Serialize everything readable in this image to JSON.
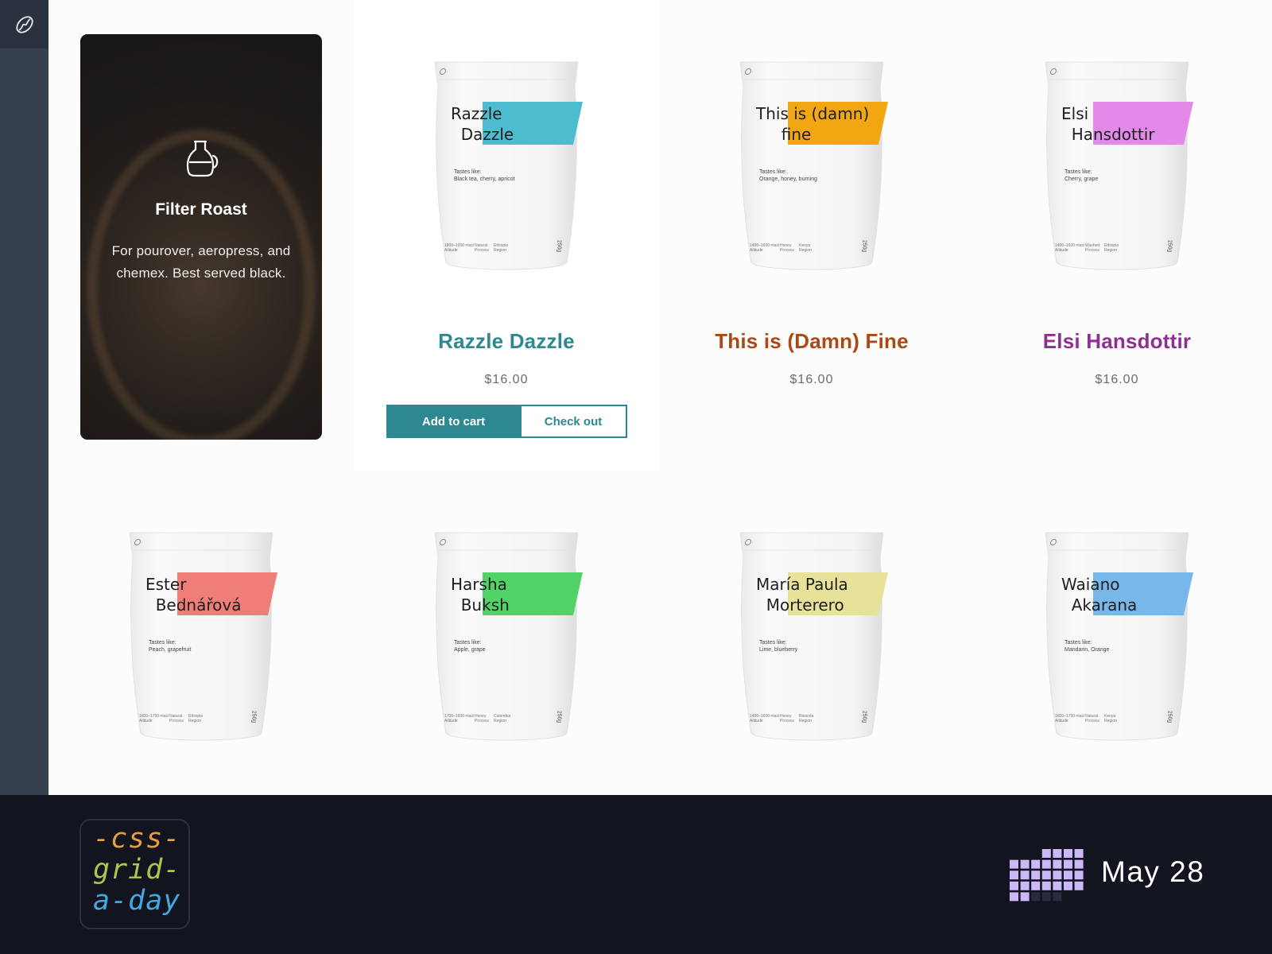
{
  "sidebar": {
    "logo_icon": "coffee-bean-icon"
  },
  "feature": {
    "icon": "coffee-pot-icon",
    "title": "Filter Roast",
    "description": "For pourover, aeropress, and chemex. Best served black."
  },
  "bag_common": {
    "tastes_label": "Tastes like:",
    "weight": "250g",
    "process_label": "Process",
    "region_label": "Region",
    "altitude_label": "Altitude"
  },
  "products": [
    {
      "name": "Razzle Dazzle",
      "bag_name": "Razzle\n  Dazzle",
      "tastes": "Black tea, cherry, apricot",
      "price": "$16.00",
      "color": "#2e8891",
      "bag_color": "#4bbdcf",
      "altitude": "1800–1950 masl",
      "process": "Natural",
      "region": "Ethiopia"
    },
    {
      "name": "This is (Damn) Fine",
      "bag_name": "This is (damn)\n     fine",
      "tastes": "Orange, honey, burning",
      "price": "$16.00",
      "color": "#a84a14",
      "bag_color": "#f2a611",
      "altitude": "1400–1600 masl",
      "process": "Honey",
      "region": "Kenya"
    },
    {
      "name": "Elsi Hansdottir",
      "bag_name": "Elsi\n  Hansdottir",
      "tastes": "Cherry, grape",
      "price": "$16.00",
      "color": "#8e2f92",
      "bag_color": "#e389e8",
      "altitude": "1400–1500 masl",
      "process": "Washed",
      "region": "Ethiopia"
    },
    {
      "name": "",
      "bag_name": "Ester\n  Bednářová",
      "tastes": "Peach, grapefruit",
      "price": "",
      "color": "#cc4c4c",
      "bag_color": "#ef7d78",
      "altitude": "1600–1750 masl",
      "process": "Natural",
      "region": "Ethiopia"
    },
    {
      "name": "",
      "bag_name": "Harsha\n  Buksh",
      "tastes": "Apple, grape",
      "price": "",
      "color": "#2a9d3c",
      "bag_color": "#52d36a",
      "altitude": "1700–1900 masl",
      "process": "Honey",
      "region": "Colombia"
    },
    {
      "name": "",
      "bag_name": "María Paula\n  Morterero",
      "tastes": "Lime, blueberry",
      "price": "",
      "color": "#b4ad46",
      "bag_color": "#e7e19a",
      "altitude": "1400–1600 masl",
      "process": "Honey",
      "region": "Rwanda"
    },
    {
      "name": "",
      "bag_name": "Waiano\n  Akarana",
      "tastes": "Mandarin, Orange",
      "price": "",
      "color": "#3a7fbf",
      "bag_color": "#78b7ea",
      "altitude": "1600–1750 masl",
      "process": "Natural",
      "region": "Kenya"
    }
  ],
  "actions": {
    "add_to_cart": "Add to cart",
    "check_out": "Check out"
  },
  "footer": {
    "badge_lines": [
      "-css-",
      "grid-",
      "a-day"
    ],
    "badge_colors": [
      "#e59d45",
      "#aac84a",
      "#44a7e0"
    ],
    "calendar_icon": "calendar-grid-icon",
    "date": "May 28"
  }
}
